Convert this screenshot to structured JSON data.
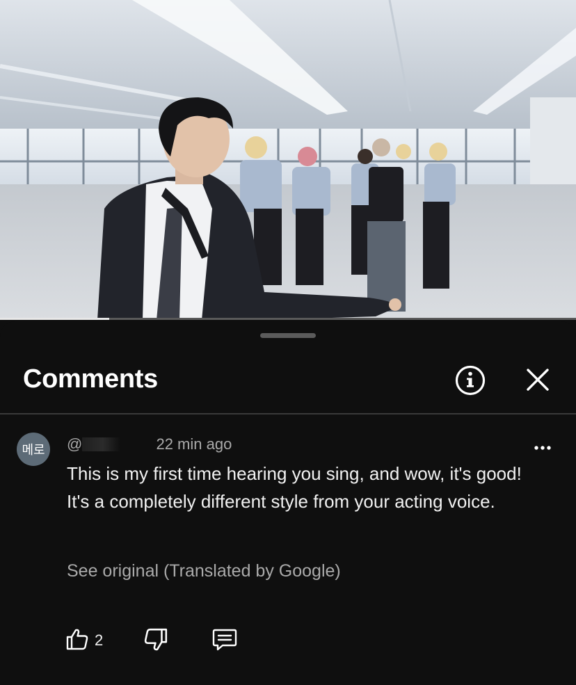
{
  "player": {
    "progress_fraction": 0.19
  },
  "comments_panel": {
    "title": "Comments",
    "info_icon": "info-circle-icon",
    "close_icon": "close-icon"
  },
  "comment": {
    "avatar_text": "메로",
    "handle_prefix": "@",
    "timestamp": "22 min ago",
    "body": "This is my first time hearing you sing, and wow, it's good! It's a completely different style from your acting voice.",
    "see_original": "See original (Translated by Google)",
    "like_count": "2",
    "more_icon": "more-options-icon",
    "like_icon": "thumbs-up-icon",
    "dislike_icon": "thumbs-down-icon",
    "reply_icon": "reply-icon"
  },
  "colors": {
    "background": "#0f0f0f",
    "text_primary": "#f1f1f1",
    "text_secondary": "#aaaaaa",
    "avatar_bg": "#5d6b77"
  }
}
